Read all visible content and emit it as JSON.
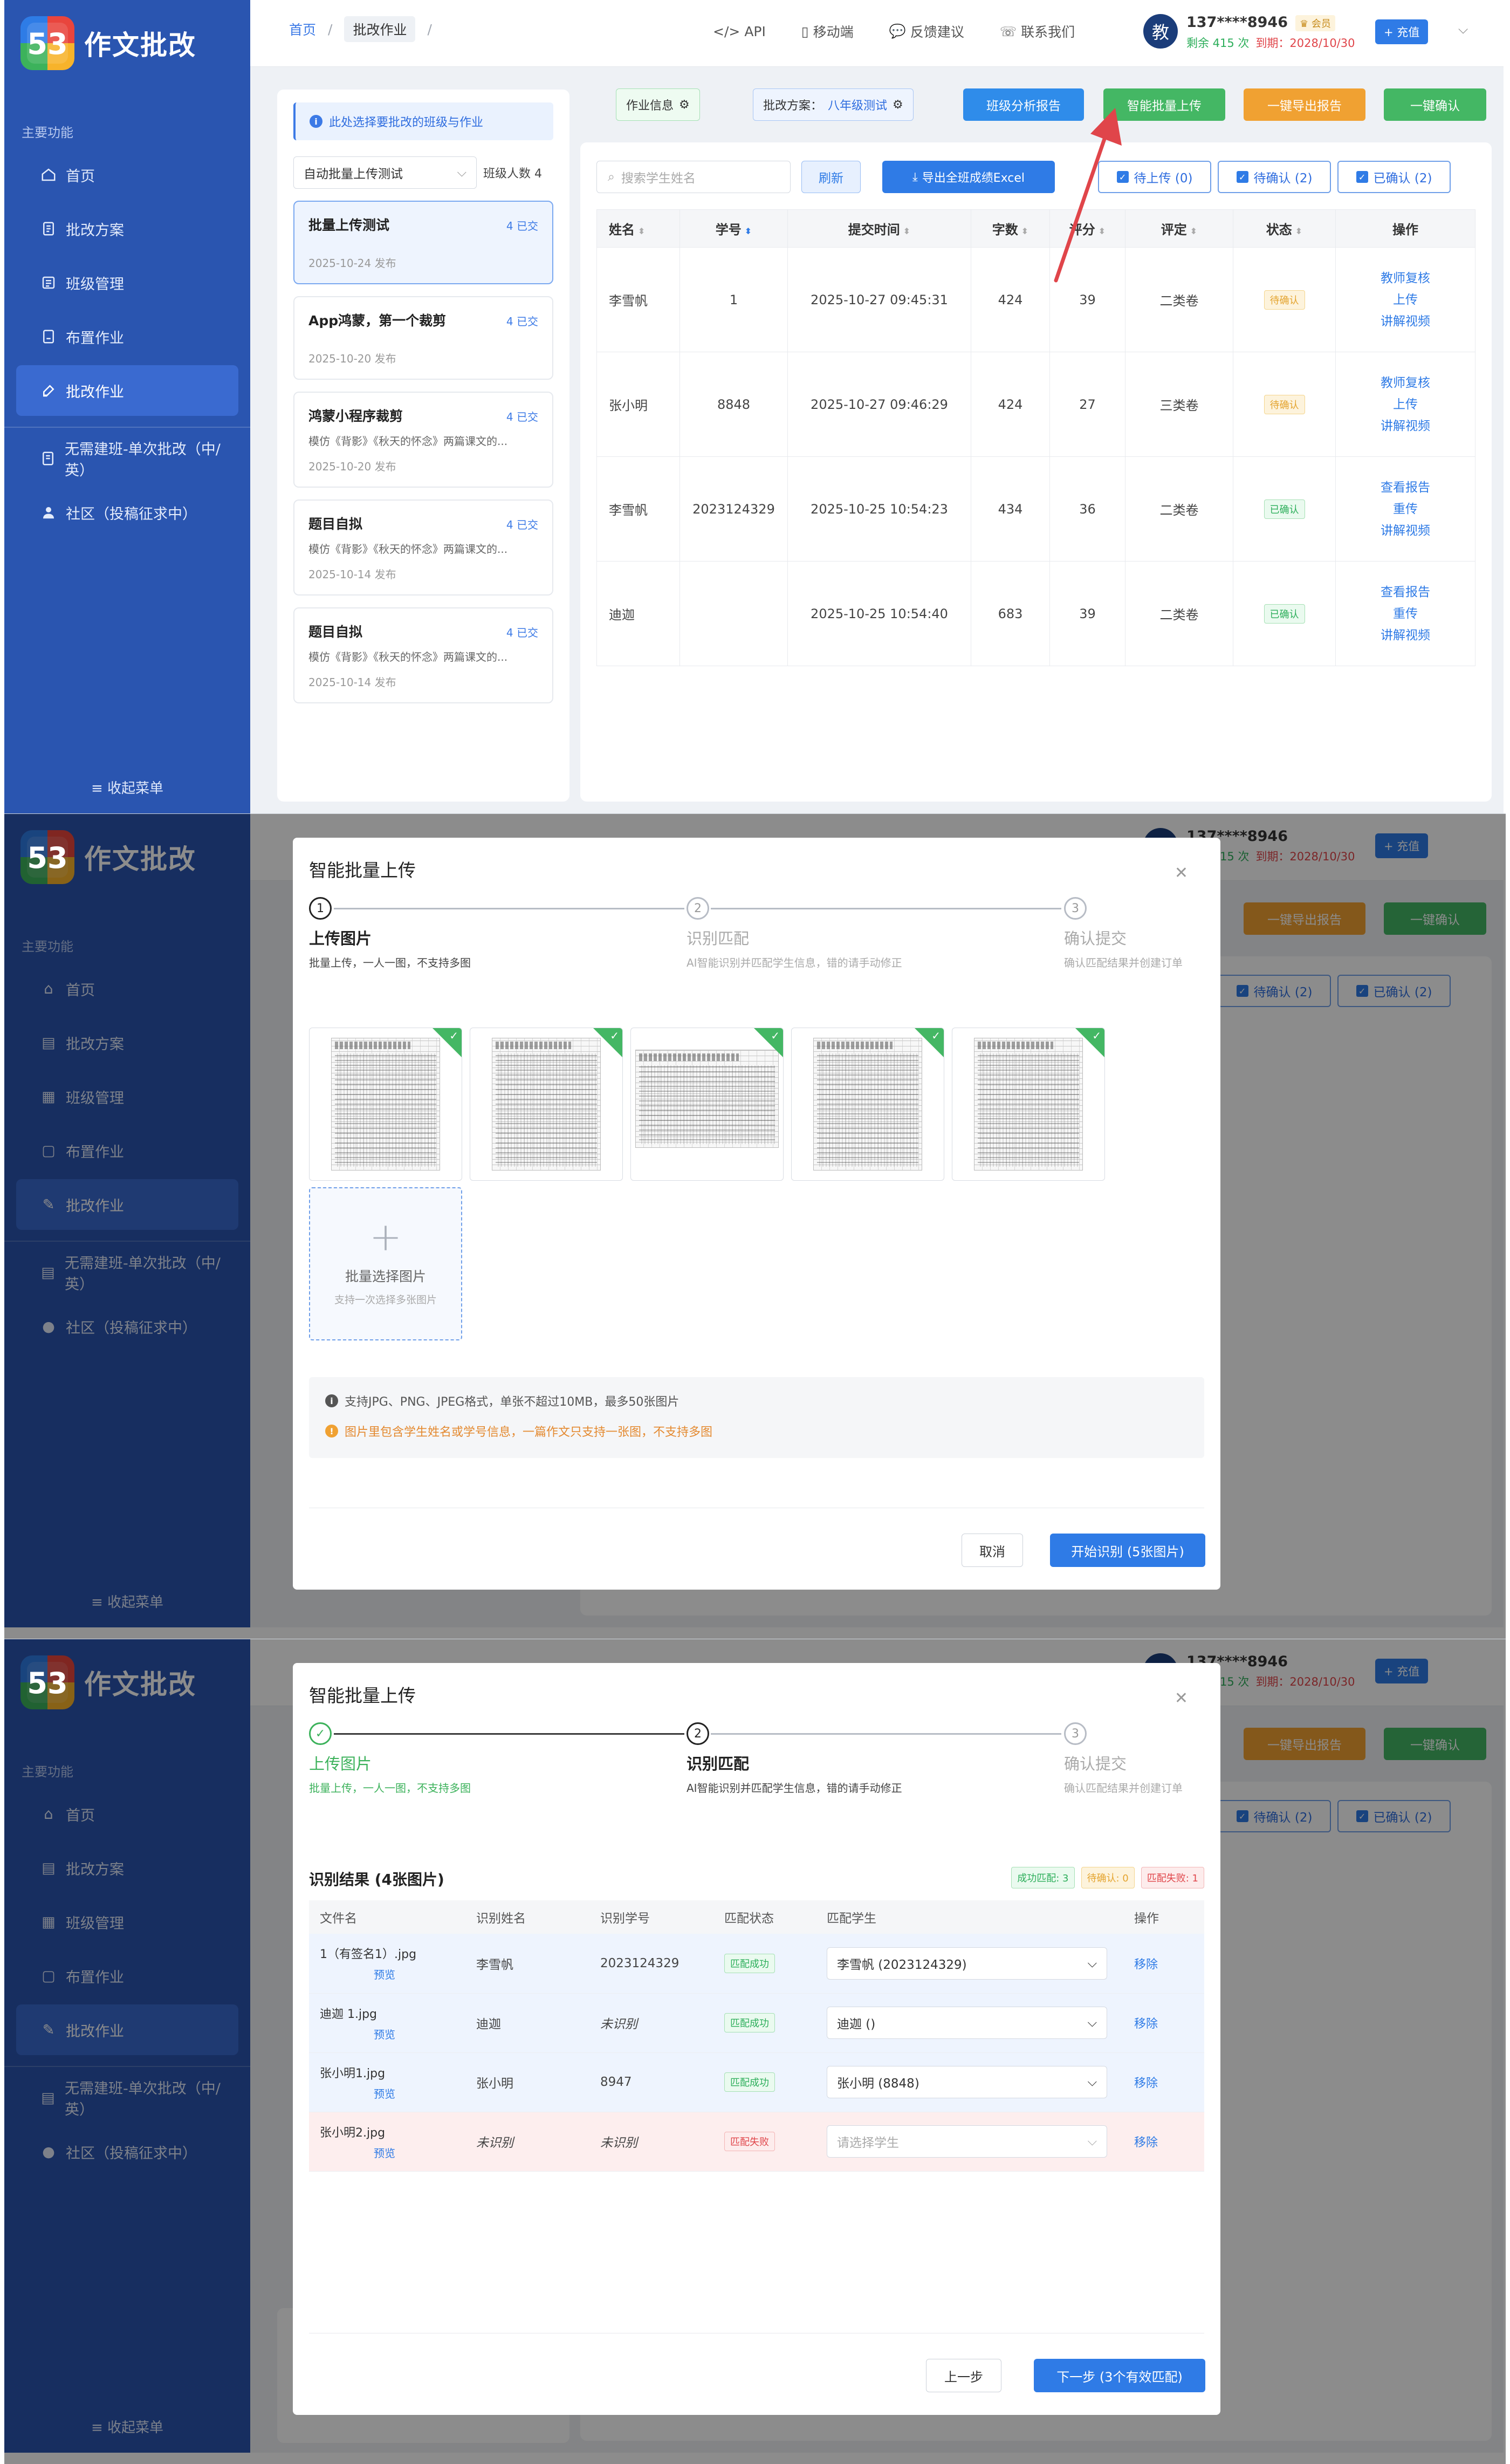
{
  "app": {
    "logo_number": "53",
    "name": "作文批改",
    "group_label": "主要功能",
    "nav": [
      "首页",
      "批改方案",
      "班级管理",
      "布置作业",
      "批改作业",
      "无需建班-单次批改（中/英）",
      "社区（投稿征求中）"
    ],
    "collapse": "收起菜单"
  },
  "header": {
    "breadcrumb_home": "首页",
    "breadcrumb_current": "批改作业",
    "links": [
      "API",
      "移动端",
      "反馈建议",
      "联系我们"
    ],
    "avatar_text": "教",
    "phone": "137****8946",
    "vip": "会员",
    "remaining": "剩余 415 次",
    "expiry": "到期：2028/10/30",
    "recharge": "+ 充值"
  },
  "list": {
    "tip": "此处选择要批改的班级与作业",
    "class_select": "自动批量上传测试",
    "class_count": "班级人数 4",
    "tasks": [
      {
        "title": "批量上传测试",
        "count": "4 已交",
        "desc": "",
        "date": "2025-10-24 发布"
      },
      {
        "title": "App鸿蒙，第一个裁剪",
        "count": "4 已交",
        "desc": "",
        "date": "2025-10-20 发布"
      },
      {
        "title": "鸿蒙小程序裁剪",
        "count": "4 已交",
        "desc": "模仿《背影》《秋天的怀念》两篇课文的...",
        "date": "2025-10-20 发布"
      },
      {
        "title": "题目自拟",
        "count": "4 已交",
        "desc": "模仿《背影》《秋天的怀念》两篇课文的...",
        "date": "2025-10-14 发布"
      },
      {
        "title": "题目自拟",
        "count": "4 已交",
        "desc": "模仿《背影》《秋天的怀念》两篇课文的...",
        "date": "2025-10-14 发布"
      }
    ]
  },
  "main": {
    "info_tag": "作业信息",
    "plan_label": "批改方案：",
    "plan_value": "八年级测试",
    "buttons": [
      "班级分析报告",
      "智能批量上传",
      "一键导出报告",
      "一键确认"
    ],
    "search_placeholder": "搜索学生姓名",
    "refresh": "刷新",
    "export_excel": "导出全班成绩Excel",
    "filters": [
      "待上传 (0)",
      "待确认 (2)",
      "已确认 (2)"
    ],
    "columns": [
      "姓名",
      "学号",
      "提交时间",
      "字数",
      "评分",
      "评定",
      "状态",
      "操作"
    ],
    "rows": [
      {
        "name": "李雪帆",
        "id": "1",
        "time": "2025-10-27 09:45:31",
        "words": "424",
        "score": "39",
        "grade": "二类卷",
        "status": "待确认",
        "ops": [
          "教师复核",
          "上传",
          "讲解视频"
        ]
      },
      {
        "name": "张小明",
        "id": "8848",
        "time": "2025-10-27 09:46:29",
        "words": "424",
        "score": "27",
        "grade": "三类卷",
        "status": "待确认",
        "ops": [
          "教师复核",
          "上传",
          "讲解视频"
        ]
      },
      {
        "name": "李雪帆",
        "id": "2023124329",
        "time": "2025-10-25 10:54:23",
        "words": "434",
        "score": "36",
        "grade": "二类卷",
        "status": "已确认",
        "ops": [
          "查看报告",
          "重传",
          "讲解视频"
        ]
      },
      {
        "name": "迪迦",
        "id": "",
        "time": "2025-10-25 10:54:40",
        "words": "683",
        "score": "39",
        "grade": "二类卷",
        "status": "已确认",
        "ops": [
          "查看报告",
          "重传",
          "讲解视频"
        ]
      }
    ]
  },
  "modal": {
    "title": "智能批量上传",
    "steps": [
      {
        "num": "1",
        "name": "上传图片",
        "desc": "批量上传，一人一图，不支持多图"
      },
      {
        "num": "2",
        "name": "识别匹配",
        "desc": "AI智能识别并匹配学生信息，错的请手动修正"
      },
      {
        "num": "3",
        "name": "确认提交",
        "desc": "确认匹配结果并创建订单"
      }
    ],
    "add_label": "批量选择图片",
    "add_hint": "支持一次选择多张图片",
    "info_line1": "支持JPG、PNG、JPEG格式，单张不超过10MB，最多50张图片",
    "info_line2": "图片里包含学生姓名或学号信息，一篇作文只支持一张图，不支持多图",
    "cancel": "取消",
    "start": "开始识别 (5张图片)",
    "result_title": "识别结果 (4张图片)",
    "badges": [
      "成功匹配: 3",
      "待确认: 0",
      "匹配失败: 1"
    ],
    "result_columns": [
      "文件名",
      "识别姓名",
      "识别学号",
      "匹配状态",
      "匹配学生",
      "操作"
    ],
    "results": [
      {
        "file": "1（有签名1）.jpg",
        "preview": "预览",
        "name": "李雪帆",
        "id": "2023124329",
        "status": "匹配成功",
        "student": "李雪帆 (2023124329)",
        "op": "移除"
      },
      {
        "file": "迪迦 1.jpg",
        "preview": "预览",
        "name": "迪迦",
        "id": "未识别",
        "status": "匹配成功",
        "student": "迪迦 ()",
        "op": "移除"
      },
      {
        "file": "张小明1.jpg",
        "preview": "预览",
        "name": "张小明",
        "id": "8947",
        "status": "匹配成功",
        "student": "张小明 (8848)",
        "op": "移除"
      },
      {
        "file": "张小明2.jpg",
        "preview": "预览",
        "name": "未识别",
        "id": "未识别",
        "status": "匹配失败",
        "student": "请选择学生",
        "op": "移除"
      }
    ],
    "prev": "上一步",
    "next": "下一步 (3个有效匹配)"
  },
  "colors": {
    "sidebar": "#2a55b0",
    "primary": "#2f7be6",
    "green": "#44b764",
    "orange": "#f0a132",
    "red": "#e0454a"
  }
}
